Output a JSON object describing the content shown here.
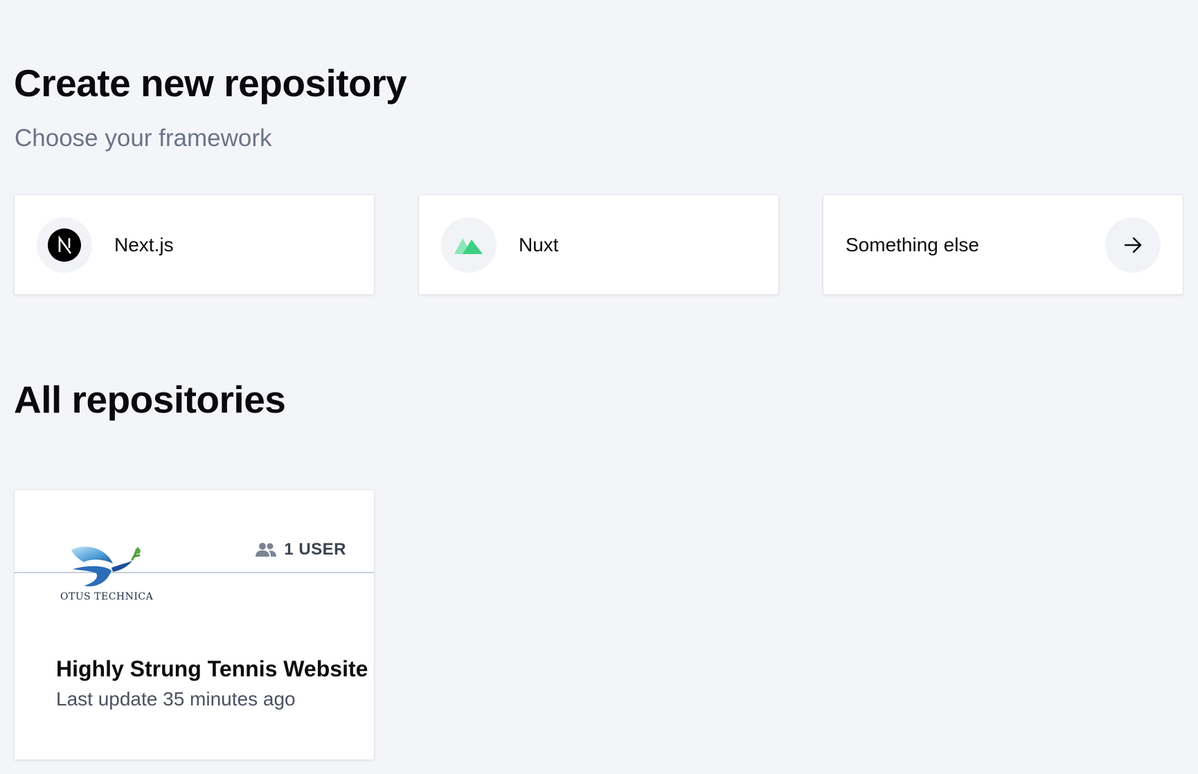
{
  "create": {
    "title": "Create new repository",
    "subtitle": "Choose your framework"
  },
  "frameworks": [
    {
      "label": "Next.js",
      "icon": "nextjs-logo-icon"
    },
    {
      "label": "Nuxt",
      "icon": "nuxt-logo-icon",
      "color": "#00dc82"
    },
    {
      "label": "Something else",
      "icon": "arrow-right-icon"
    }
  ],
  "repositories": {
    "title": "All repositories",
    "items": [
      {
        "name": "Highly Strung Tennis Website",
        "updated": "Last update 35 minutes ago",
        "users": "1 USER",
        "thumbnail_text": "OTUS TECHNICA"
      }
    ]
  }
}
